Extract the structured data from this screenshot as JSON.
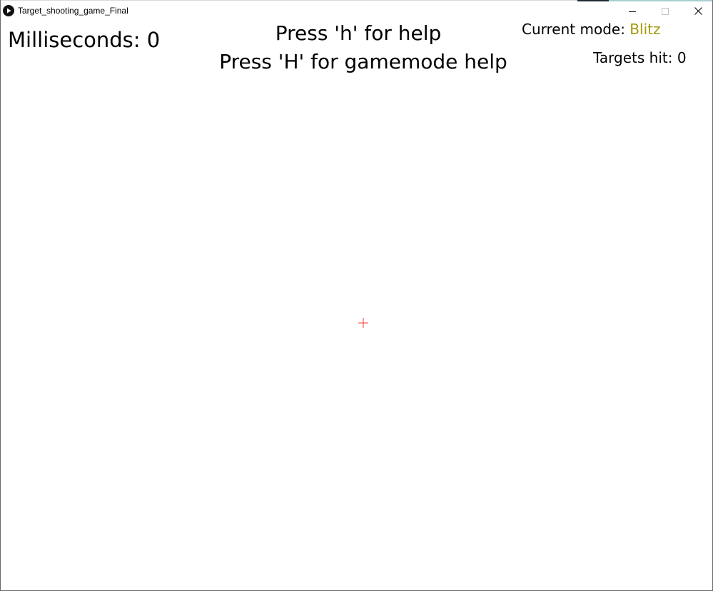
{
  "window": {
    "title": "Target_shooting_game_Final",
    "controls": {
      "minimize_icon": "minimize-icon",
      "maximize_icon": "maximize-icon",
      "close_icon": "close-icon"
    }
  },
  "hud": {
    "milliseconds_label": "Milliseconds:",
    "milliseconds_value": "0",
    "help_line_1": "Press 'h' for help",
    "help_line_2": "Press 'H' for gamemode help",
    "mode_label": "Current mode:",
    "mode_value": "Blitz",
    "targets_label": "Targets hit:",
    "targets_value": "0"
  },
  "colors": {
    "background": "#ffffff",
    "text": "#000000",
    "mode_accent": "#a29a08",
    "crosshair": "#ff3b3b"
  },
  "cursor": {
    "icon": "crosshair-icon"
  }
}
